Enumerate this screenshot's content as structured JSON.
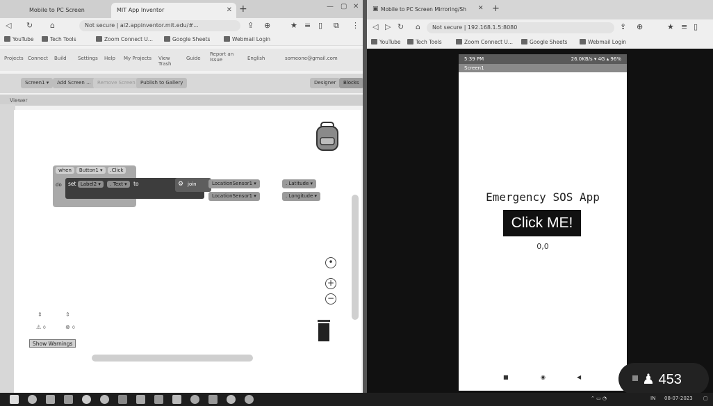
{
  "left_browser": {
    "tabs": [
      {
        "label": "Mobile to PC Screen"
      },
      {
        "label": "MIT App Inventor"
      }
    ],
    "url": "Not secure | ai2.appinventor.mit.edu/#...",
    "bookmarks": [
      "YouTube",
      "Tech Tools",
      "Zoom Connect U...",
      "Google Sheets",
      "Webmail Login"
    ],
    "menu": [
      "Projects",
      "Connect",
      "Build",
      "Settings",
      "Help",
      "My Projects",
      "View Trash",
      "Guide",
      "Report an Issue",
      "English",
      "someone@gmail.com"
    ],
    "toolbar": {
      "screen_select": "Screen1 ▾",
      "add_screen": "Add Screen ...",
      "remove_screen": "Remove Screen",
      "publish": "Publish to Gallery",
      "designer": "Designer",
      "blocks": "Blocks"
    },
    "viewer_label": "Viewer",
    "blocks": {
      "event": [
        "when",
        "Button1 ▾",
        ".Click"
      ],
      "do_label": "do",
      "set": [
        "set",
        "Label2 ▾",
        ". Text ▾",
        "to"
      ],
      "join": "join",
      "loc1": [
        "LocationSensor1 ▾",
        ". Latitude ▾"
      ],
      "loc2": [
        "LocationSensor1 ▾",
        ". Longitude ▾"
      ]
    },
    "warnings": {
      "count1": "0",
      "count2": "0",
      "button": "Show Warnings"
    }
  },
  "right_browser": {
    "tab_label": "Mobile to PC Screen Mirroring/Sh",
    "url": "Not secure | 192.168.1.5:8080",
    "bookmarks": [
      "YouTube",
      "Tech Tools",
      "Zoom Connect U...",
      "Google Sheets",
      "Webmail Login"
    ],
    "phone": {
      "status_time": "5:39 PM",
      "status_right": "26.0KB/s ▾ 4G ▴ 96%",
      "title": "Screen1",
      "app_label": "Emergency SOS App",
      "button": "Click ME!",
      "coords": "0,0",
      "nav": [
        "■",
        "◉",
        "◀"
      ]
    }
  },
  "viewer_badge": {
    "count": "453",
    "icon": "person-icon"
  },
  "taskbar": {
    "tray_lang": "IN",
    "tray_date": "08-07-2023"
  }
}
